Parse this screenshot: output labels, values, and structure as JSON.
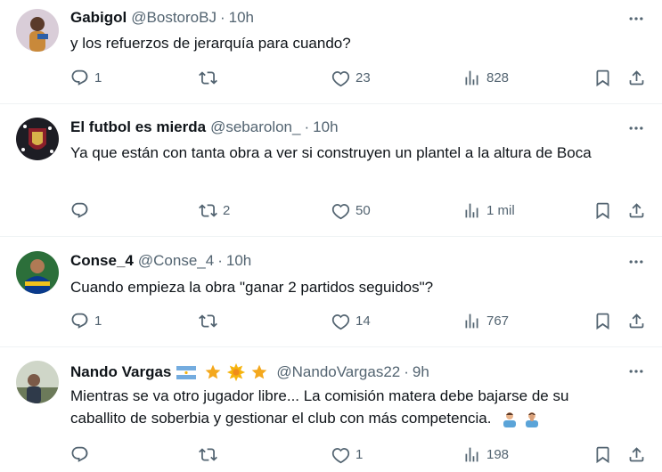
{
  "colors": {
    "text": "#0f1419",
    "muted": "#536471",
    "border": "#eff3f4",
    "star": "#f4a81d"
  },
  "icons": {
    "reply": "reply-icon",
    "retweet": "retweet-icon",
    "like": "heart-icon",
    "views": "views-icon",
    "bookmark": "bookmark-icon",
    "share": "share-icon",
    "more": "more-icon"
  },
  "tweets": [
    {
      "name": "Gabigol",
      "handle": "@BostoroBJ",
      "dot": "·",
      "time": "10h",
      "text": "y los refuerzos de jerarquía para cuando?",
      "replies": "1",
      "retweets": "",
      "likes": "23",
      "views": "828"
    },
    {
      "name": "El futbol es mierda",
      "handle": "@sebarolon_",
      "dot": "·",
      "time": "10h",
      "text": "Ya que están con tanta obra a ver si construyen un plantel a la altura de Boca",
      "replies": "",
      "retweets": "2",
      "likes": "50",
      "views": "1 mil"
    },
    {
      "name": "Conse_4",
      "handle": "@Conse_4",
      "dot": "·",
      "time": "10h",
      "text": "Cuando empieza la obra \"ganar 2 partidos seguidos\"?",
      "replies": "1",
      "retweets": "",
      "likes": "14",
      "views": "767"
    },
    {
      "name": "Nando Vargas",
      "handle": "@NandoVargas22",
      "dot": "·",
      "time": "9h",
      "text": "Mientras se va otro jugador libre... La comisión matera debe bajarse de su caballito de soberbia y gestionar el club con más competencia.",
      "replies": "",
      "retweets": "",
      "likes": "1",
      "views": "198"
    }
  ]
}
